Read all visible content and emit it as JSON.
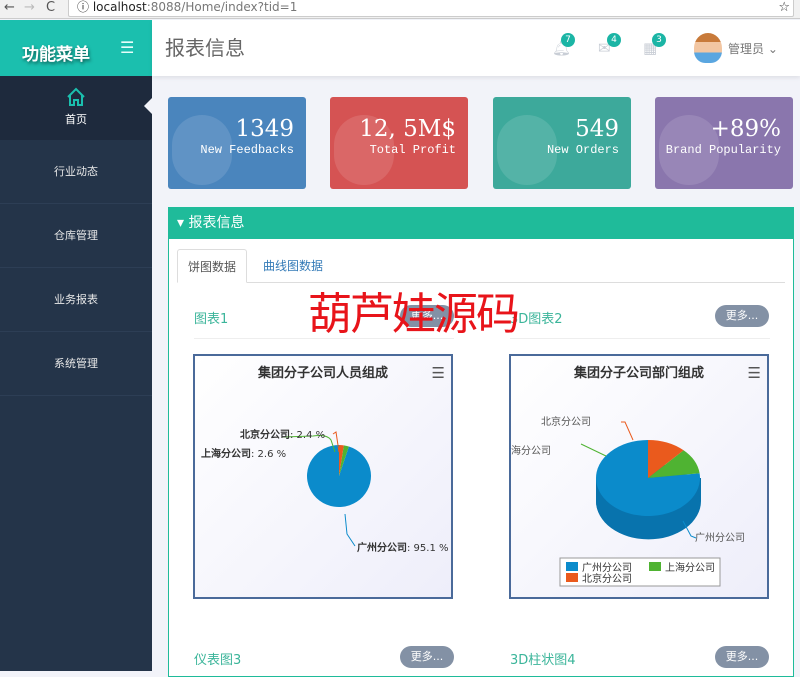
{
  "browser": {
    "back": "←",
    "forward": "→",
    "reload": "C",
    "url_host": "localhost",
    "url_rest": ":8088/Home/index?tid=1",
    "star": "☆"
  },
  "sidebar": {
    "title": "功能菜单",
    "items": [
      {
        "label": "首页"
      },
      {
        "label": "行业动态"
      },
      {
        "label": "仓库管理"
      },
      {
        "label": "业务报表"
      },
      {
        "label": "系统管理"
      }
    ]
  },
  "header": {
    "title": "报表信息",
    "notifications": "7",
    "messages": "4",
    "tasks": "3",
    "user": "管理员"
  },
  "cards": [
    {
      "value": "1349",
      "label": "New Feedbacks",
      "color": "#4a85bd"
    },
    {
      "value": "12, 5M$",
      "label": "Total Profit",
      "color": "#d55353"
    },
    {
      "value": "549",
      "label": "New Orders",
      "color": "#3da99b"
    },
    {
      "value": "+89%",
      "label": "Brand Popularity",
      "color": "#8a76ad"
    }
  ],
  "panel": {
    "title": "报表信息",
    "tabs": [
      "饼图数据",
      "曲线图数据"
    ]
  },
  "sections": [
    {
      "title": "图表1",
      "more": "更多..."
    },
    {
      "title": "3D图表2",
      "more": "更多..."
    },
    {
      "title": "仪表图3",
      "more": "更多..."
    },
    {
      "title": "3D柱状图4",
      "more": "更多..."
    }
  ],
  "watermark": "葫芦娃源码",
  "chart_data": [
    {
      "type": "pie",
      "title": "集团分子公司人员组成",
      "categories": [
        "广州分公司",
        "上海分公司",
        "北京分公司"
      ],
      "values": [
        95.1,
        2.6,
        2.4
      ],
      "labels": [
        "广州分公司: 95.1 %",
        "上海分公司: 2.6 %",
        "北京分公司: 2.4 %"
      ],
      "colors": [
        "#0b8bcb",
        "#4fb332",
        "#ea5a1d"
      ]
    },
    {
      "type": "pie",
      "title": "集团分子公司部门组成",
      "categories": [
        "广州分公司",
        "上海分公司",
        "北京分公司"
      ],
      "values": [
        77,
        11,
        12
      ],
      "labels": [
        "广州分公司",
        "海分公司",
        "北京分公司"
      ],
      "legend": [
        "广州分公司",
        "上海分公司",
        "北京分公司"
      ],
      "colors": [
        "#0b8bcb",
        "#4fb332",
        "#ea5a1d"
      ],
      "legend_position": "bottom"
    }
  ]
}
